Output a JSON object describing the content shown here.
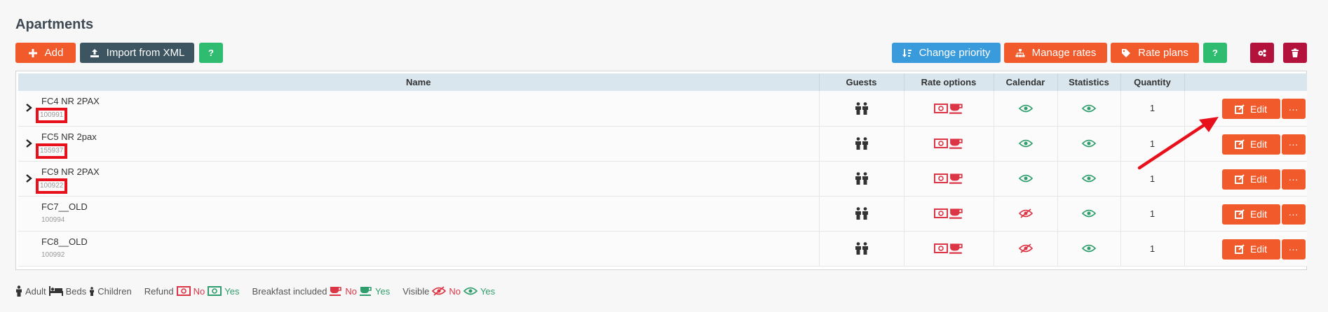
{
  "page": {
    "title": "Apartments"
  },
  "toolbar": {
    "add_label": "Add",
    "import_label": "Import from XML",
    "help_label": "?",
    "change_priority_label": "Change priority",
    "manage_rates_label": "Manage rates",
    "rate_plans_label": "Rate plans",
    "help2_label": "?"
  },
  "table": {
    "headers": {
      "name": "Name",
      "guests": "Guests",
      "rate_options": "Rate options",
      "calendar": "Calendar",
      "statistics": "Statistics",
      "quantity": "Quantity"
    },
    "rows": [
      {
        "name": "FC4 NR 2PAX",
        "id": "100991",
        "quantity": "1",
        "calendar_visible": true,
        "edit_label": "Edit",
        "more_label": "···"
      },
      {
        "name": "FC5 NR 2pax",
        "id": "155937",
        "quantity": "1",
        "calendar_visible": true,
        "edit_label": "Edit",
        "more_label": "···"
      },
      {
        "name": "FC9 NR 2PAX",
        "id": "100922",
        "quantity": "1",
        "calendar_visible": true,
        "edit_label": "Edit",
        "more_label": "···"
      },
      {
        "name": "FC7__OLD",
        "id": "100994",
        "quantity": "1",
        "calendar_visible": false,
        "edit_label": "Edit",
        "more_label": "···"
      },
      {
        "name": "FC8__OLD",
        "id": "100992",
        "quantity": "1",
        "calendar_visible": false,
        "edit_label": "Edit",
        "more_label": "···"
      }
    ]
  },
  "legend": {
    "adult": "Adult",
    "beds": "Beds",
    "children": "Children",
    "refund": "Refund",
    "refund_no": "No",
    "refund_yes": "Yes",
    "breakfast": "Breakfast included",
    "breakfast_no": "No",
    "breakfast_yes": "Yes",
    "visible": "Visible",
    "visible_no": "No",
    "visible_yes": "Yes"
  },
  "colors": {
    "orange": "#f15a2b",
    "dark_slate": "#3d5560",
    "green": "#2fbb70",
    "blue": "#3a9bdc",
    "maroon": "#b3123c",
    "highlight_red": "#e8101b"
  }
}
